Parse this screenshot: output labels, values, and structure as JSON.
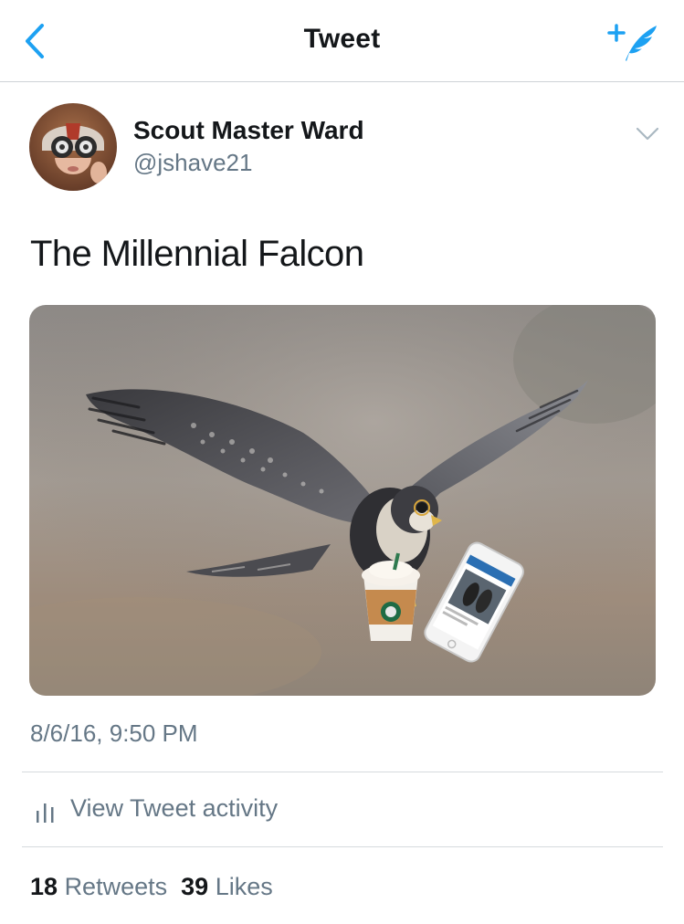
{
  "nav": {
    "title": "Tweet",
    "accent_color": "#1da1f2"
  },
  "tweet": {
    "author": {
      "display_name": "Scout Master Ward",
      "handle": "@jshave21"
    },
    "text": "The Millennial Falcon",
    "media_icon": "falcon-photo",
    "timestamp": "8/6/16, 9:50 PM",
    "activity_label": "View Tweet activity",
    "stats": {
      "retweets_count": "18",
      "retweets_label": "Retweets",
      "likes_count": "39",
      "likes_label": "Likes"
    }
  },
  "colors": {
    "primary_text": "#14171a",
    "secondary_text": "#657786",
    "accent": "#1da1f2",
    "divider": "#d6dadd"
  }
}
